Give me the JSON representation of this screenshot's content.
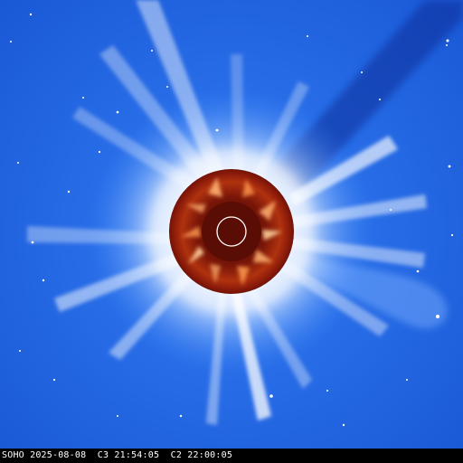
{
  "image": {
    "caption": "SOHO 2025-08-08  C3 21:54:05  C2 22:00:05"
  },
  "colors": {
    "background_blue": "#1f63e0",
    "corona_white": "#ffffff",
    "occulter_red": "#8a1a0a",
    "occulter_orange": "#ff8a3a",
    "caption_bar": "#000000",
    "caption_text": "#ffffff"
  },
  "elements": {
    "sun_outline_icon": "sun-disk-outline",
    "occulter": "coronagraph-occulting-disk"
  }
}
